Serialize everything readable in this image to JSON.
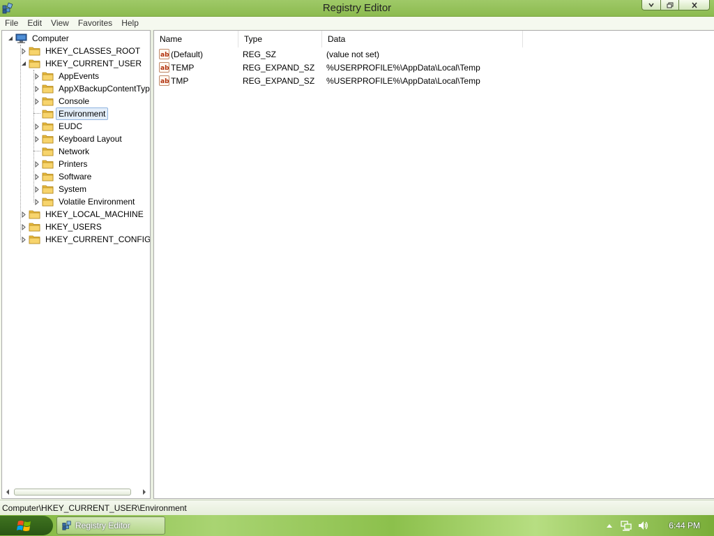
{
  "window": {
    "title": "Registry Editor",
    "controls": {
      "minimize": "minimize-icon",
      "maximize": "restore-icon",
      "close": "close-icon"
    }
  },
  "menu": [
    "File",
    "Edit",
    "View",
    "Favorites",
    "Help"
  ],
  "tree": {
    "root": "Computer",
    "nodes": [
      {
        "label": "HKEY_CLASSES_ROOT",
        "level": 1,
        "expander": "collapsed"
      },
      {
        "label": "HKEY_CURRENT_USER",
        "level": 1,
        "expander": "expanded"
      },
      {
        "label": "AppEvents",
        "level": 2,
        "expander": "collapsed"
      },
      {
        "label": "AppXBackupContentTyp",
        "level": 2,
        "expander": "collapsed"
      },
      {
        "label": "Console",
        "level": 2,
        "expander": "collapsed"
      },
      {
        "label": "Environment",
        "level": 2,
        "expander": "none",
        "selected": true
      },
      {
        "label": "EUDC",
        "level": 2,
        "expander": "collapsed"
      },
      {
        "label": "Keyboard Layout",
        "level": 2,
        "expander": "collapsed"
      },
      {
        "label": "Network",
        "level": 2,
        "expander": "none"
      },
      {
        "label": "Printers",
        "level": 2,
        "expander": "collapsed"
      },
      {
        "label": "Software",
        "level": 2,
        "expander": "collapsed"
      },
      {
        "label": "System",
        "level": 2,
        "expander": "collapsed"
      },
      {
        "label": "Volatile Environment",
        "level": 2,
        "expander": "collapsed"
      },
      {
        "label": "HKEY_LOCAL_MACHINE",
        "level": 1,
        "expander": "collapsed"
      },
      {
        "label": "HKEY_USERS",
        "level": 1,
        "expander": "collapsed"
      },
      {
        "label": "HKEY_CURRENT_CONFIG",
        "level": 1,
        "expander": "collapsed"
      }
    ]
  },
  "list": {
    "columns": [
      "Name",
      "Type",
      "Data"
    ],
    "rows": [
      {
        "icon": "string-value-icon",
        "name": "(Default)",
        "type": "REG_SZ",
        "data": "(value not set)"
      },
      {
        "icon": "string-value-icon",
        "name": "TEMP",
        "type": "REG_EXPAND_SZ",
        "data": "%USERPROFILE%\\AppData\\Local\\Temp"
      },
      {
        "icon": "string-value-icon",
        "name": "TMP",
        "type": "REG_EXPAND_SZ",
        "data": "%USERPROFILE%\\AppData\\Local\\Temp"
      }
    ]
  },
  "status": {
    "path": "Computer\\HKEY_CURRENT_USER\\Environment"
  },
  "taskbar": {
    "start": "start-orb-icon",
    "apps": [
      {
        "label": "Registry Editor",
        "icon": "registry-editor-icon"
      }
    ],
    "tray": [
      "show-hidden-icons",
      "network-icon",
      "volume-icon"
    ],
    "clock": "6:44 PM"
  },
  "colors": {
    "titlebar": "#9fc968",
    "selection": "#e4eef9",
    "taskbar": "#8cc04c"
  }
}
